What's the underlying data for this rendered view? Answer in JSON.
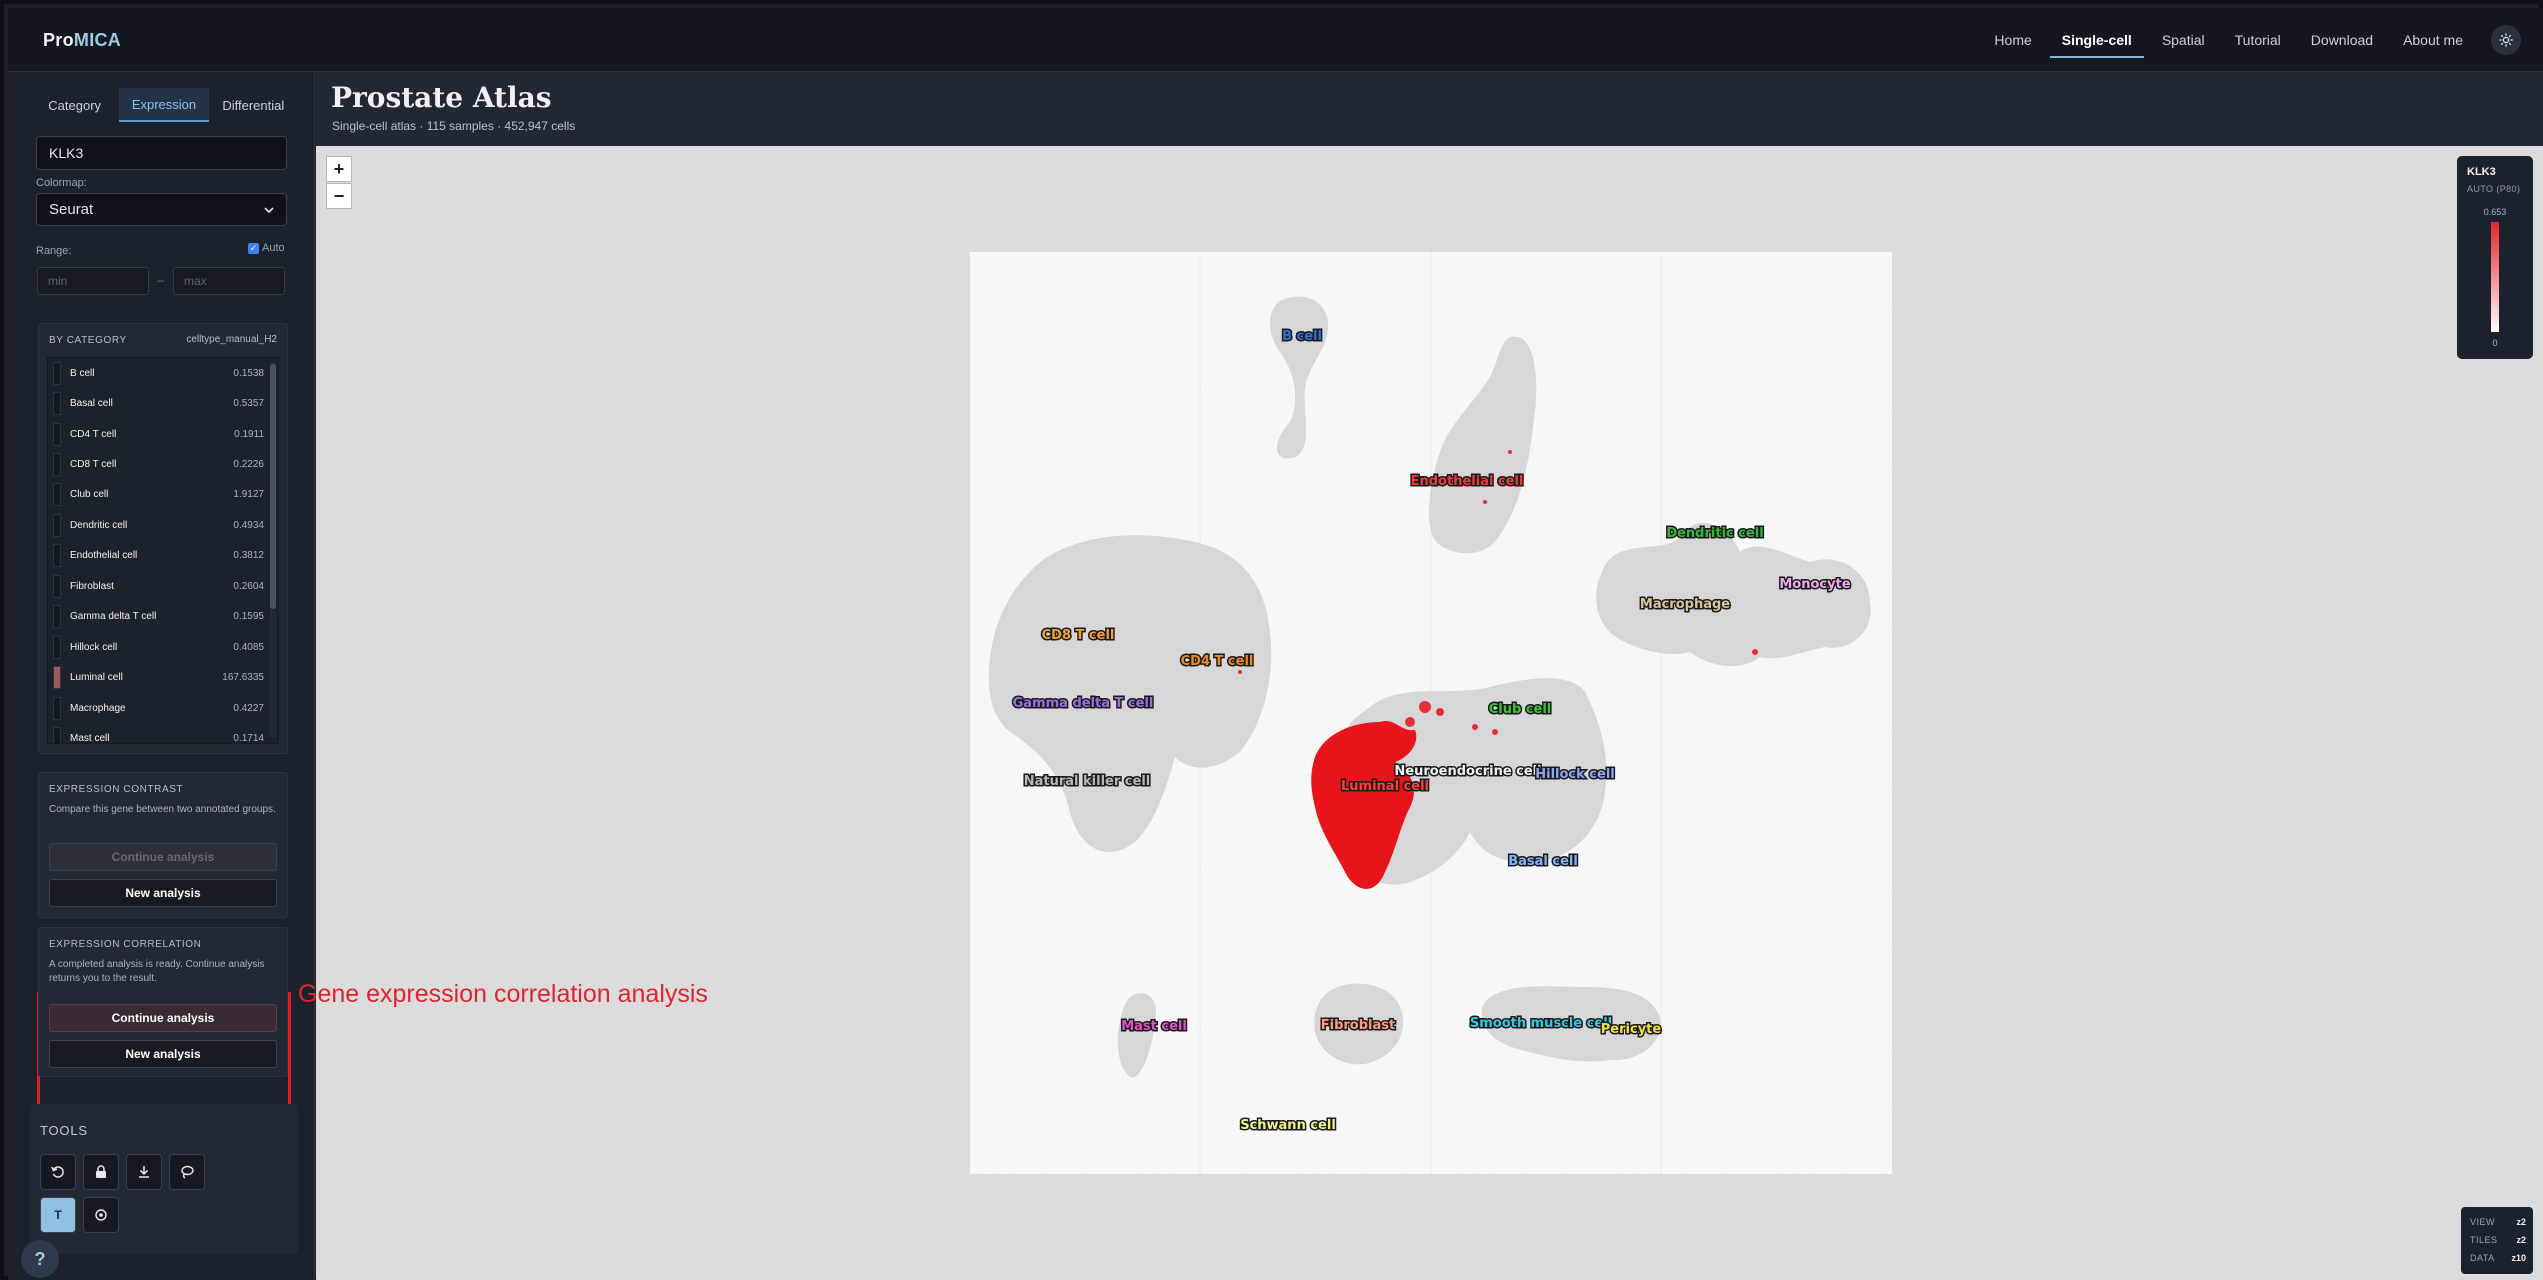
{
  "app": {
    "logo_prefix": "Pro",
    "logo_suffix": "MICA"
  },
  "nav": {
    "items": [
      "Home",
      "Single-cell",
      "Spatial",
      "Tutorial",
      "Download",
      "About me"
    ],
    "active": "Single-cell"
  },
  "sidebar": {
    "tabs": [
      "Category",
      "Expression",
      "Differential"
    ],
    "active_tab": "Expression",
    "gene_value": "KLK3",
    "colormap_label": "Colormap:",
    "colormap_value": "Seurat",
    "range_label": "Range:",
    "auto_label": "Auto",
    "auto_checked": true,
    "min_placeholder": "min",
    "max_placeholder": "max",
    "range_separator": "–",
    "by_category_title": "BY CATEGORY",
    "by_category_field": "celltype_manual_H2",
    "categories": [
      {
        "name": "B cell",
        "value": "0.1538"
      },
      {
        "name": "Basal cell",
        "value": "0.5357"
      },
      {
        "name": "CD4 T cell",
        "value": "0.1911"
      },
      {
        "name": "CD8 T cell",
        "value": "0.2226"
      },
      {
        "name": "Club cell",
        "value": "1.9127"
      },
      {
        "name": "Dendritic cell",
        "value": "0.4934"
      },
      {
        "name": "Endothelial cell",
        "value": "0.3812"
      },
      {
        "name": "Fibroblast",
        "value": "0.2604"
      },
      {
        "name": "Gamma delta T cell",
        "value": "0.1595"
      },
      {
        "name": "Hillock cell",
        "value": "0.4085"
      },
      {
        "name": "Luminal cell",
        "value": "167.6335"
      },
      {
        "name": "Macrophage",
        "value": "0.4227"
      },
      {
        "name": "Mast cell",
        "value": "0.1714"
      }
    ],
    "contrast": {
      "title": "EXPRESSION CONTRAST",
      "desc": "Compare this gene between two annotated groups.",
      "continue_label": "Continue analysis",
      "new_label": "New analysis"
    },
    "correlation": {
      "title": "EXPRESSION CORRELATION",
      "desc": "A completed analysis is ready. Continue analysis returns you to the result.",
      "continue_label": "Continue analysis",
      "new_label": "New analysis"
    },
    "tools_title": "TOOLS",
    "tools_icons": [
      "reset-icon",
      "lock-icon",
      "download-icon",
      "lasso-icon",
      "text-icon",
      "target-icon"
    ],
    "help_label": "?"
  },
  "main": {
    "title": "Prostate Atlas",
    "subtitle": "Single-cell atlas · 115 samples · 452,947 cells",
    "zoom_in": "+",
    "zoom_out": "−",
    "annotation": "Gene expression correlation analysis"
  },
  "legend": {
    "gene": "KLK3",
    "mode": "AUTO (P80)",
    "max": "0.653",
    "min": "0",
    "color_high": "#e8202b",
    "color_low": "#ffffff"
  },
  "status": [
    {
      "key": "VIEW",
      "value": "z2"
    },
    {
      "key": "TILES",
      "value": "z2"
    },
    {
      "key": "DATA",
      "value": "z10"
    }
  ],
  "umap": {
    "cluster_labels": [
      {
        "name": "B cell",
        "color": "#2f6fd6"
      },
      {
        "name": "Endothelial cell",
        "color": "#e83a3a"
      },
      {
        "name": "Dendritic cell",
        "color": "#35b53a"
      },
      {
        "name": "Monocyte",
        "color": "#f2a6ee"
      },
      {
        "name": "Macrophage",
        "color": "#d8c59a"
      },
      {
        "name": "CD8 T cell",
        "color": "#f0a030"
      },
      {
        "name": "CD4 T cell",
        "color": "#f08a1a"
      },
      {
        "name": "Gamma delta T cell",
        "color": "#9b6ee0"
      },
      {
        "name": "Club cell",
        "color": "#37c23b"
      },
      {
        "name": "Natural killer cell",
        "color": "#b8b8b8"
      },
      {
        "name": "Neuroendocrine cell",
        "color": "#f2f2f2"
      },
      {
        "name": "Hillock cell",
        "color": "#8fa5f0"
      },
      {
        "name": "Luminal cell",
        "color": "#ff3b3b"
      },
      {
        "name": "Basal cell",
        "color": "#7fb3f5"
      },
      {
        "name": "Mast cell",
        "color": "#e050c8"
      },
      {
        "name": "Fibroblast",
        "color": "#ff9a7a"
      },
      {
        "name": "Smooth muscle cell",
        "color": "#38c7e0"
      },
      {
        "name": "Pericyte",
        "color": "#f2e23a"
      },
      {
        "name": "Schwann cell",
        "color": "#f0f08a"
      }
    ]
  }
}
